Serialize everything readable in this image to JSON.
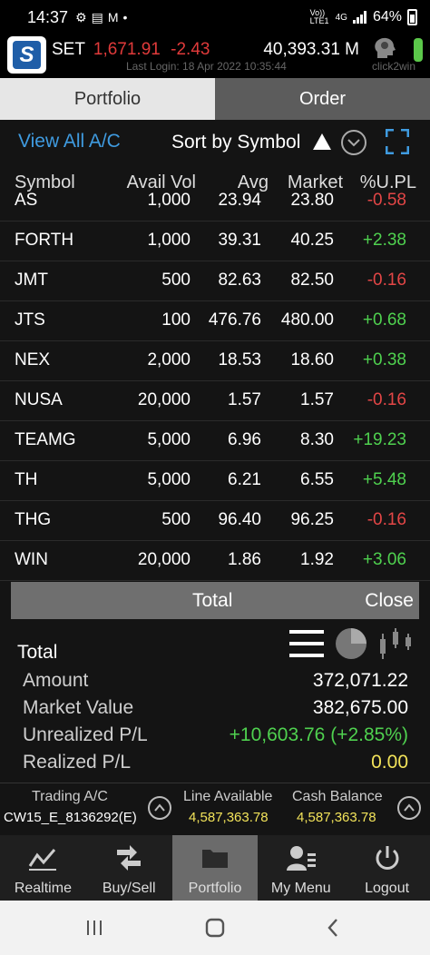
{
  "status_bar": {
    "time": "14:37",
    "network_label": "Vo)) LTE1",
    "signal_label": "4G",
    "battery": "64%"
  },
  "header": {
    "market": "SET",
    "index": "1,671.91",
    "change": "-2.43",
    "value": "40,393.31 M",
    "last_login": "Last Login: 18 Apr 2022 10:35:44",
    "brand": "click2win"
  },
  "tabs": [
    {
      "label": "Portfolio",
      "active": true
    },
    {
      "label": "Order",
      "active": false
    }
  ],
  "toolbar": {
    "view_all": "View All A/C",
    "sort_label": "Sort by Symbol"
  },
  "columns": {
    "symbol": "Symbol",
    "avail_vol": "Avail Vol",
    "avg": "Avg",
    "market": "Market",
    "upl": "%U.PL"
  },
  "rows": [
    {
      "symbol": "AS",
      "avail_vol": "1,000",
      "avg": "23.94",
      "market": "23.80",
      "upl": "-0.58",
      "status": "neg"
    },
    {
      "symbol": "FORTH",
      "avail_vol": "1,000",
      "avg": "39.31",
      "market": "40.25",
      "upl": "+2.38",
      "status": "pos"
    },
    {
      "symbol": "JMT",
      "avail_vol": "500",
      "avg": "82.63",
      "market": "82.50",
      "upl": "-0.16",
      "status": "neg"
    },
    {
      "symbol": "JTS",
      "avail_vol": "100",
      "avg": "476.76",
      "market": "480.00",
      "upl": "+0.68",
      "status": "pos"
    },
    {
      "symbol": "NEX",
      "avail_vol": "2,000",
      "avg": "18.53",
      "market": "18.60",
      "upl": "+0.38",
      "status": "pos"
    },
    {
      "symbol": "NUSA",
      "avail_vol": "20,000",
      "avg": "1.57",
      "market": "1.57",
      "upl": "-0.16",
      "status": "neg"
    },
    {
      "symbol": "TEAMG",
      "avail_vol": "5,000",
      "avg": "6.96",
      "market": "8.30",
      "upl": "+19.23",
      "status": "pos"
    },
    {
      "symbol": "TH",
      "avail_vol": "5,000",
      "avg": "6.21",
      "market": "6.55",
      "upl": "+5.48",
      "status": "pos"
    },
    {
      "symbol": "THG",
      "avail_vol": "500",
      "avg": "96.40",
      "market": "96.25",
      "upl": "-0.16",
      "status": "neg"
    },
    {
      "symbol": "WIN",
      "avail_vol": "20,000",
      "avg": "1.86",
      "market": "1.92",
      "upl": "+3.06",
      "status": "pos"
    }
  ],
  "total_bar": {
    "title": "Total",
    "close": "Close"
  },
  "summary": {
    "title": "Total",
    "items": [
      {
        "label": "Amount",
        "value": "372,071.22",
        "tone": "white"
      },
      {
        "label": "Market Value",
        "value": "382,675.00",
        "tone": "white"
      },
      {
        "label": "Unrealized P/L",
        "value": "+10,603.76 (+2.85%)",
        "tone": "green"
      },
      {
        "label": "Realized P/L",
        "value": "0.00",
        "tone": "yellow"
      }
    ],
    "view_icons": [
      "list-icon",
      "pie-chart-icon",
      "candlestick-icon"
    ]
  },
  "account": {
    "trading_label": "Trading A/C",
    "trading_value": "CW15_E_8136292(E)",
    "line_label": "Line Available",
    "line_value": "4,587,363.78",
    "cash_label": "Cash Balance",
    "cash_value": "4,587,363.78"
  },
  "bottom_nav": [
    {
      "label": "Realtime",
      "icon": "chart-line-icon",
      "active": false
    },
    {
      "label": "Buy/Sell",
      "icon": "buy-sell-arrows-icon",
      "active": false
    },
    {
      "label": "Portfolio",
      "icon": "folder-icon",
      "active": true
    },
    {
      "label": "My Menu",
      "icon": "user-menu-icon",
      "active": false
    },
    {
      "label": "Logout",
      "icon": "power-icon",
      "active": false
    }
  ],
  "colors": {
    "positive": "#4fd14f",
    "negative": "#e34646",
    "link": "#3f9be0",
    "realized": "#f2e35a"
  }
}
